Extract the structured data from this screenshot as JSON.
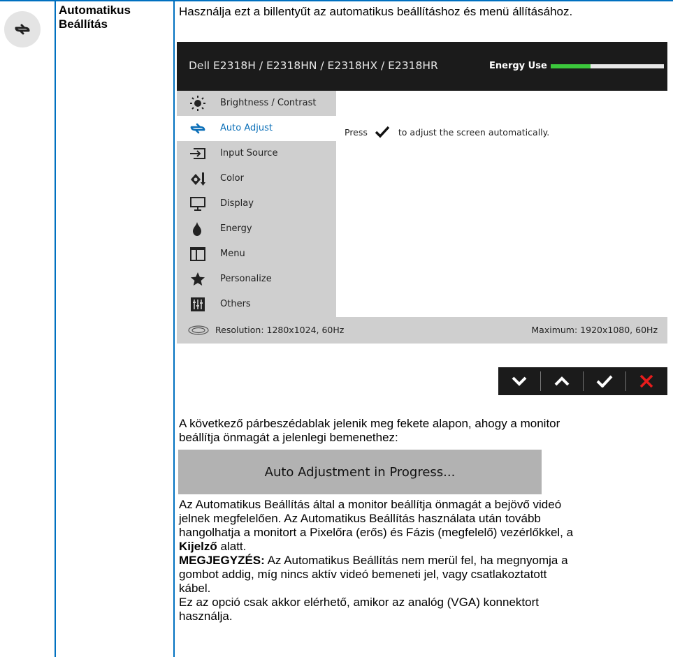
{
  "feature": {
    "icon": "auto-adjust-icon",
    "title_line1": "Automatikus",
    "title_line2": "Beállítás",
    "intro": "Használja ezt a billentyűt az automatikus beállításhoz és menü állításához."
  },
  "osd": {
    "model": "Dell E2318H / E2318HN / E2318HX / E2318HR",
    "energy_label": "Energy Use",
    "energy_level_percent": 35,
    "colors": {
      "header_bg": "#1b1b1b",
      "sidebar_bg": "#cfcfcf",
      "accent": "#0b6fb8",
      "energy_bar": "#3cc83c"
    },
    "menu": [
      {
        "icon": "brightness-icon",
        "label": "Brightness / Contrast"
      },
      {
        "icon": "auto-adjust-icon",
        "label": "Auto Adjust",
        "active": true
      },
      {
        "icon": "input-source-icon",
        "label": "Input Source"
      },
      {
        "icon": "color-icon",
        "label": "Color"
      },
      {
        "icon": "display-icon",
        "label": "Display"
      },
      {
        "icon": "energy-icon",
        "label": "Energy"
      },
      {
        "icon": "menu-icon",
        "label": "Menu"
      },
      {
        "icon": "star-icon",
        "label": "Personalize"
      },
      {
        "icon": "others-icon",
        "label": "Others"
      }
    ],
    "press_before": "Press",
    "press_after": "to adjust the screen automatically.",
    "resolution": "Resolution: 1280x1024, 60Hz",
    "maximum": "Maximum: 1920x1080, 60Hz"
  },
  "nav_buttons": [
    "down-arrow-icon",
    "up-arrow-icon",
    "check-icon",
    "close-icon"
  ],
  "dialog_intro_1": "A következő párbeszédablak jelenik meg fekete alapon, ahogy a monitor",
  "dialog_intro_2": "beállítja önmagát a jelenlegi bemenethez:",
  "progress_text": "Auto Adjustment in Progress...",
  "body": {
    "p1_l1": "Az Automatikus Beállítás által a monitor beállítja önmagát a bejövő videó",
    "p1_l2": "jelnek megfelelően. Az Automatikus Beállítás használata után tovább",
    "p1_l3": "hangolhatja a monitort a Pixelőra (erős) és Fázis (megfelelő) vezérlőkkel, a",
    "p1_bold": "Kijelző",
    "p1_end": " alatt.",
    "note_label": "MEGJEGYZÉS:",
    "note_l1": " Az Automatikus Beállítás nem merül fel, ha megnyomja a",
    "note_l2": "gombot addig, míg nincs aktív videó bemeneti jel, vagy csatlakoztatott",
    "note_l3": "kábel.",
    "p3_l1": "Ez az opció csak akkor elérhető, amikor az analóg (VGA) konnektort",
    "p3_l2": "használja."
  }
}
